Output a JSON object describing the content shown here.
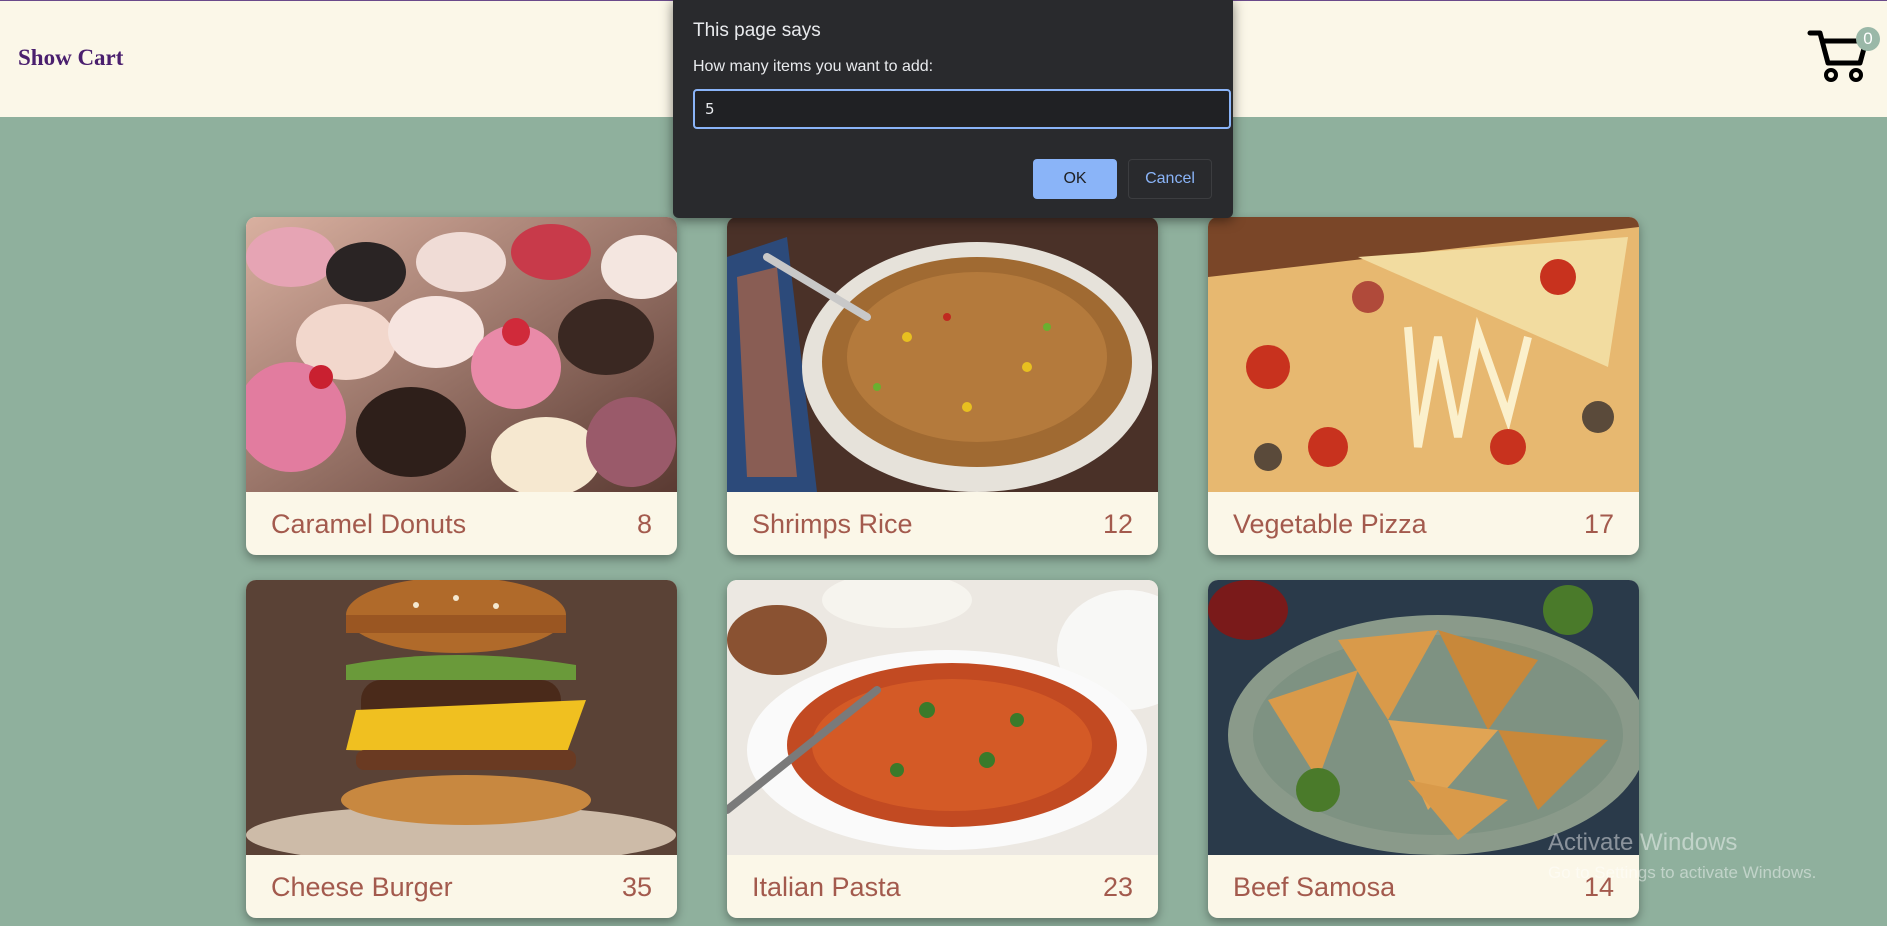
{
  "header": {
    "show_cart_label": "Show Cart",
    "cart_count": "0"
  },
  "products": [
    {
      "name": "Caramel Donuts",
      "price": "8"
    },
    {
      "name": "Shrimps Rice",
      "price": "12"
    },
    {
      "name": "Vegetable Pizza",
      "price": "17"
    },
    {
      "name": "Cheese Burger",
      "price": "35"
    },
    {
      "name": "Italian Pasta",
      "price": "23"
    },
    {
      "name": "Beef Samosa",
      "price": "14"
    }
  ],
  "dialog": {
    "title": "This page says",
    "message": "How many items you want to add:",
    "input_value": "5",
    "ok_label": "OK",
    "cancel_label": "Cancel"
  },
  "watermark": {
    "line1": "Activate Windows",
    "line2": "Go to Settings to activate Windows."
  },
  "colors": {
    "background": "#8fb09d",
    "header": "#fbf7e8",
    "brand": "#4a1f6e",
    "price": "#a35a4d",
    "dialog": "#292a2d",
    "accent": "#8ab4f8"
  },
  "icons": {
    "cart": "shopping-cart-icon"
  }
}
